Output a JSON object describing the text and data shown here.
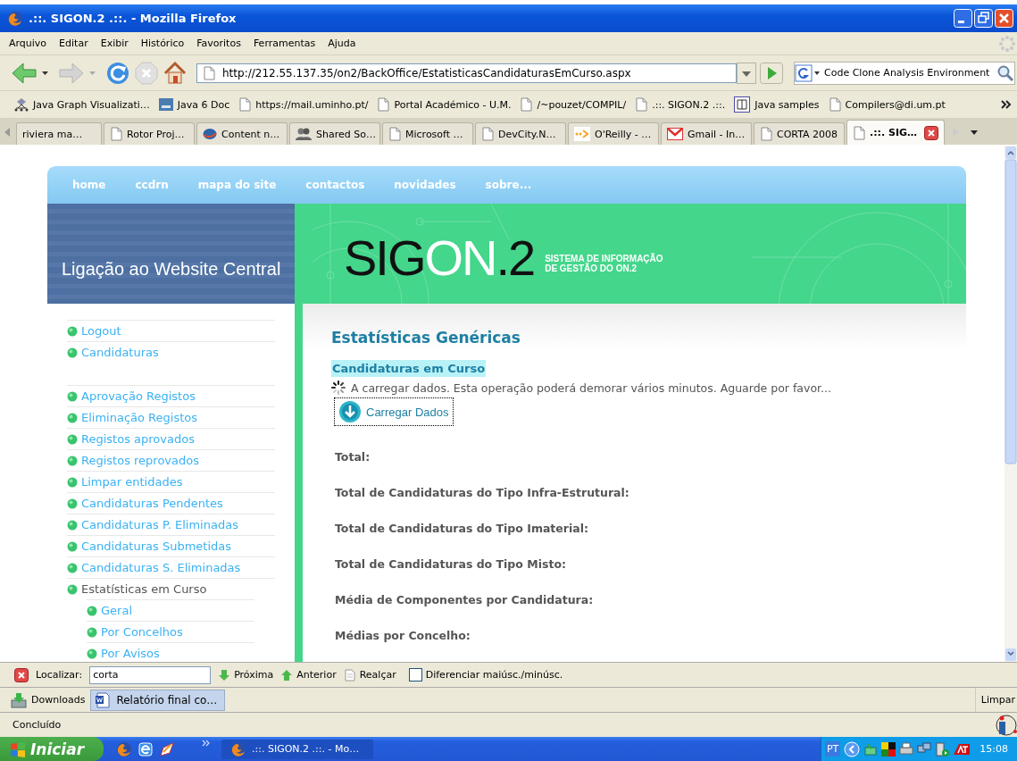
{
  "window": {
    "title": ".::. SIGON.2 .::. - Mozilla Firefox"
  },
  "menu": [
    "Arquivo",
    "Editar",
    "Exibir",
    "Histórico",
    "Favoritos",
    "Ferramentas",
    "Ajuda"
  ],
  "toolbar": {
    "url": "http://212.55.137.35/on2/BackOffice/EstatisticasCandidaturasEmCurso.aspx",
    "search": "Code Clone Analysis Environment"
  },
  "bookmarks": [
    {
      "label": "Java Graph Visualizati…",
      "kind": "graph"
    },
    {
      "label": "Java 6 Doc",
      "kind": "sun"
    },
    {
      "label": "https://mail.uminho.pt/",
      "kind": "page"
    },
    {
      "label": "Portal Académico - U.M.",
      "kind": "page"
    },
    {
      "label": "/~pouzet/COMPIL/",
      "kind": "page"
    },
    {
      "label": ".::. SIGON.2 .::.",
      "kind": "page"
    },
    {
      "label": "Java samples",
      "kind": "samples"
    },
    {
      "label": "Compilers@di.um.pt",
      "kind": "page"
    }
  ],
  "tabs": [
    {
      "label": "riviera ma…",
      "selected": false,
      "kind": "none"
    },
    {
      "label": "Rotor Proj…",
      "selected": false,
      "kind": "page"
    },
    {
      "label": "Content n…",
      "selected": false,
      "kind": "globe"
    },
    {
      "label": "Shared So…",
      "selected": false,
      "kind": "people"
    },
    {
      "label": "Microsoft …",
      "selected": false,
      "kind": "page"
    },
    {
      "label": "DevCity.N…",
      "selected": false,
      "kind": "page"
    },
    {
      "label": "O'Reilly - …",
      "selected": false,
      "kind": "feed"
    },
    {
      "label": "Gmail - In…",
      "selected": false,
      "kind": "mail"
    },
    {
      "label": "CORTA 2008",
      "selected": false,
      "kind": "page"
    },
    {
      "label": ".::. SIG…",
      "selected": true,
      "kind": "page"
    }
  ],
  "site_nav": [
    "home",
    "ccdrn",
    "mapa do site",
    "contactos",
    "novidades",
    "sobre..."
  ],
  "banner": {
    "link": "Ligação ao Website Central",
    "logo": {
      "dark": "SIG",
      "light": "ON",
      "end": ".2"
    },
    "tagline": [
      "SISTEMA DE INFORMAÇÃO",
      "DE GESTÃO DO ON.2"
    ]
  },
  "sidebar": {
    "groups": [
      [
        {
          "label": "Logout",
          "selected": false
        },
        {
          "label": "Candidaturas",
          "selected": false
        }
      ],
      [
        {
          "label": "Aprovação Registos",
          "selected": false
        },
        {
          "label": "Eliminação Registos",
          "selected": false
        },
        {
          "label": "Registos aprovados",
          "selected": false
        },
        {
          "label": "Registos reprovados",
          "selected": false
        },
        {
          "label": "Limpar entidades",
          "selected": false
        },
        {
          "label": "Candidaturas Pendentes",
          "selected": false
        },
        {
          "label": "Candidaturas P. Eliminadas",
          "selected": false
        },
        {
          "label": "Candidaturas Submetidas",
          "selected": false
        },
        {
          "label": "Candidaturas S. Eliminadas",
          "selected": false
        },
        {
          "label": "Estatísticas em Curso",
          "selected": true,
          "children": [
            {
              "label": "Geral",
              "selected": false
            },
            {
              "label": "Por Concelhos",
              "selected": false
            },
            {
              "label": "Por Avisos",
              "selected": false
            }
          ]
        }
      ]
    ]
  },
  "content": {
    "heading": "Estatísticas Genéricas",
    "section": "Candidaturas em Curso",
    "loading": "A carregar dados. Esta operação poderá demorar vários minutos. Aguarde por favor...",
    "button": "Carregar Dados",
    "fields": [
      "Total:",
      "Total de Candidaturas do Tipo Infra-Estrutural:",
      "Total de Candidaturas do Tipo Imaterial:",
      "Total de Candidaturas do Tipo Misto:",
      "Média de Componentes por Candidatura:",
      "Médias por Concelho:"
    ]
  },
  "find_bar": {
    "label": "Localizar:",
    "value": "corta",
    "next": "Próxima",
    "previous": "Anterior",
    "highlight": "Realçar",
    "match_case": {
      "label": "Diferenciar maiúsc./minúsc.",
      "checked": false
    }
  },
  "downloads": {
    "label": "Downloads",
    "item": "Relatório final co…",
    "clear": "Limpar"
  },
  "status_bar": {
    "text": "Concluído"
  },
  "taskbar": {
    "start": "Iniciar",
    "window": ".::. SIGON.2 .::. - Mo…",
    "language": "PT",
    "time": "15:08"
  }
}
